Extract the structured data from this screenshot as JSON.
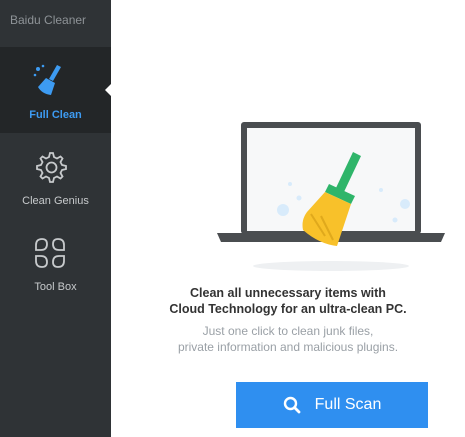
{
  "app": {
    "title": "Baidu Cleaner"
  },
  "sidebar": {
    "items": [
      {
        "label": "Full Clean",
        "icon": "broom-icon",
        "active": true
      },
      {
        "label": "Clean Genius",
        "icon": "gear-icon",
        "active": false
      },
      {
        "label": "Tool Box",
        "icon": "toolbox-grid-icon",
        "active": false
      }
    ]
  },
  "main": {
    "headline_line1": "Clean all unnecessary items with",
    "headline_line2": "Cloud Technology for an ultra-clean PC.",
    "subtext_line1": "Just one click to clean junk files,",
    "subtext_line2": "private information and malicious plugins.",
    "scan_button_label": "Full Scan",
    "scan_icon": "search-icon"
  },
  "colors": {
    "sidebar_bg": "#2f3336",
    "active_item_bg": "#232628",
    "accent_blue": "#2f8ff0",
    "broom_green": "#2fb56a",
    "broom_yellow": "#f8c12a"
  }
}
